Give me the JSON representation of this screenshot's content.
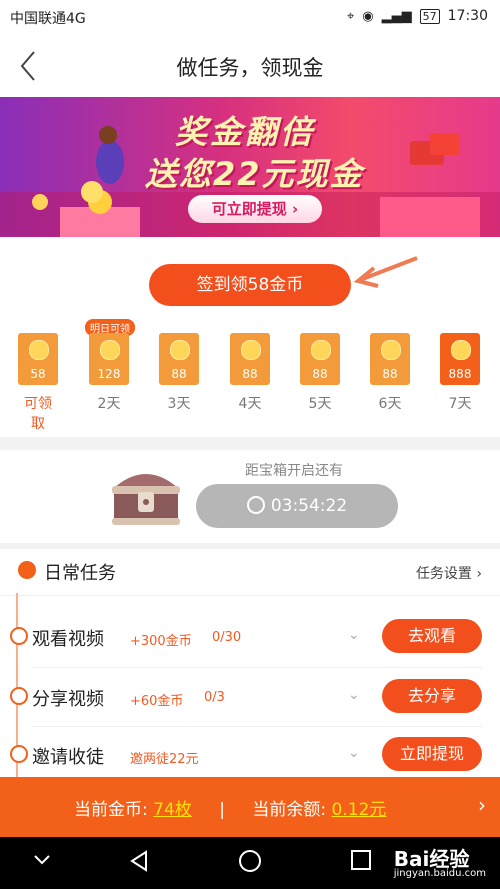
{
  "status_bar": {
    "carrier": "中国联通4G",
    "battery": "57",
    "time": "17:30",
    "network": "4G"
  },
  "nav": {
    "title": "做任务，领现金"
  },
  "banner": {
    "line1": "奖金翻倍",
    "line2": "送您22元现金",
    "cta": "可立即提现"
  },
  "signin": {
    "button": "签到领58金币",
    "tomorrow_badge": "明日可领",
    "days": [
      {
        "amount": "58",
        "label": "可领取",
        "active": true
      },
      {
        "amount": "128",
        "label": "2天"
      },
      {
        "amount": "88",
        "label": "3天"
      },
      {
        "amount": "88",
        "label": "4天"
      },
      {
        "amount": "88",
        "label": "5天"
      },
      {
        "amount": "88",
        "label": "6天"
      },
      {
        "amount": "888",
        "label": "7天"
      }
    ]
  },
  "chest": {
    "title": "距宝箱开启还有",
    "timer": "03:54:22"
  },
  "tasks": {
    "title": "日常任务",
    "settings": "任务设置",
    "items": [
      {
        "name": "观看视频",
        "reward": "+300金币",
        "count": "0/30",
        "button": "去观看"
      },
      {
        "name": "分享视频",
        "reward": "+60金币",
        "count": "0/3",
        "button": "去分享"
      },
      {
        "name": "邀请收徒",
        "reward": "邀两徒22元",
        "count": "",
        "button": "立即提现"
      }
    ]
  },
  "footer": {
    "coins_label": "当前金币:",
    "coins_value": "74枚",
    "separator": "|",
    "balance_label": "当前余额:",
    "balance_value": "0.12元"
  },
  "watermark": {
    "brand": "Bai经验",
    "url": "jingyan.baidu.com"
  },
  "colors": {
    "accent": "#f26019",
    "button": "#f24f1d",
    "timer_bg": "#b6b6b6"
  }
}
